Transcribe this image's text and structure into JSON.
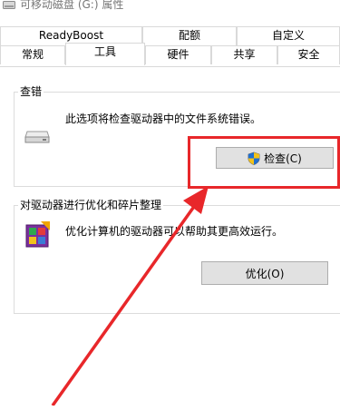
{
  "window": {
    "title": "可移动磁盘 (G:) 属性",
    "title_icon": "drive-icon"
  },
  "tabs_row1": [
    {
      "label": "ReadyBoost"
    },
    {
      "label": "配额"
    },
    {
      "label": "自定义"
    }
  ],
  "tabs_row2": [
    {
      "label": "常规"
    },
    {
      "label": "工具",
      "active": true
    },
    {
      "label": "硬件"
    },
    {
      "label": "共享"
    },
    {
      "label": "安全"
    }
  ],
  "check_section": {
    "label": "查错",
    "description": "此选项将检查驱动器中的文件系统错误。",
    "icon": "drive-icon",
    "button_label": "检查(C)",
    "button_icon": "uac-shield-icon"
  },
  "optimize_section": {
    "label": "对驱动器进行优化和碎片整理",
    "description": "优化计算机的驱动器可以帮助其更高效运行。",
    "icon": "defrag-icon",
    "button_label": "优化(O)"
  },
  "annotation": {
    "highlight_color": "#e8272a",
    "arrow_color": "#e8272a"
  }
}
